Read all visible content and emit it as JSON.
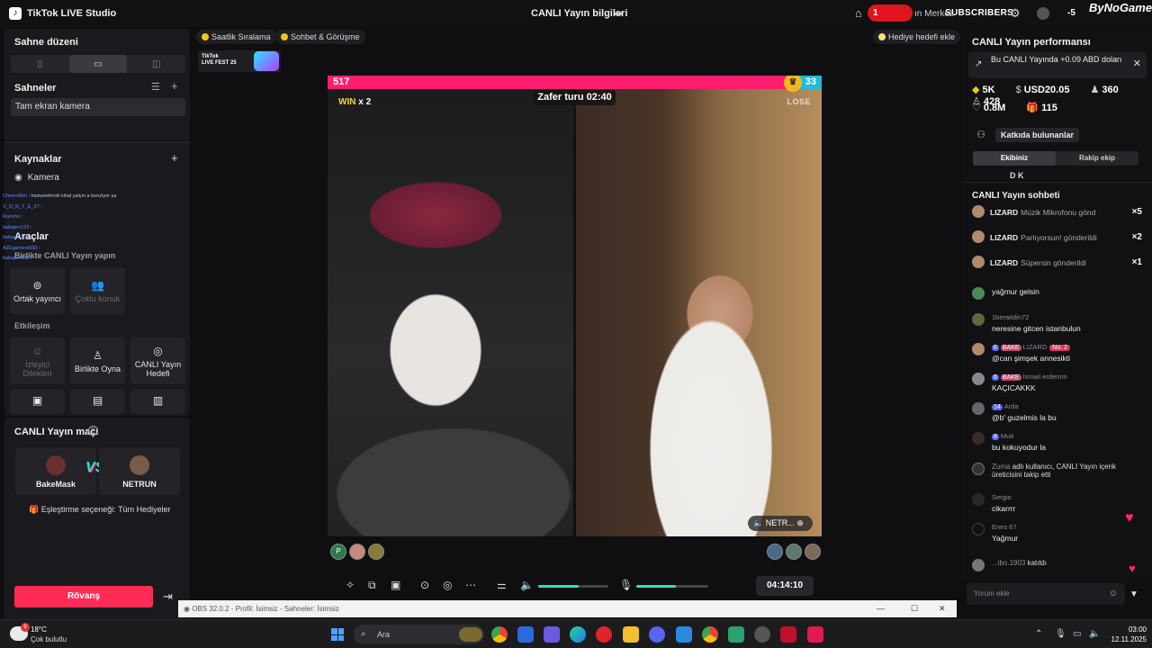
{
  "app": {
    "title": "TikTok LIVE Studio",
    "center_title": "CANLI Yayın bilgileri",
    "brand": "ByNoGame"
  },
  "topright": {
    "pill": "1",
    "yayin_merkezi": "ın Merkez",
    "subscribers": "SUBSCRIBERS",
    "count": "-5"
  },
  "left": {
    "sahne_duzeni": "Sahne düzeni",
    "sahneler": "Sahneler",
    "scene_item": "Tam ekran kamera",
    "kaynaklar": "Kaynaklar",
    "source_camera": "Kamera",
    "araclar": "Araçlar",
    "birlikte_yayin": "Birlikte CANLI Yayın yapın",
    "ortak_yayinci": "Ortak yayıncı",
    "coklu_konuk": "Çoklu konuk",
    "etkilesim": "Etkileşim",
    "izleyici_dilekleri": "İzleyici Dilekleri",
    "birlikte_oyna": "Birlikte Oyna",
    "canli_hedef": "CANLI Yayın Hedefi"
  },
  "overlay_chat": [
    {
      "user": "CheersMet",
      "text": ": hamzeefendi nihal yalçın a benziyor ya"
    },
    {
      "user": "V_O_R_T_E_X7",
      "text": ":"
    },
    {
      "user": "Runnho",
      "text": ":"
    },
    {
      "user": "babapro133",
      "text": ":"
    },
    {
      "user": "babapro133",
      "text": ":"
    },
    {
      "user": "AZEgamers033",
      "text": ":"
    },
    {
      "user": "babapro133",
      "text": ":"
    }
  ],
  "match": {
    "title": "CANLI Yayın maçı",
    "player_left": "BakeMask",
    "player_right": "NETRUN",
    "vs": "VS",
    "eslestirme": "Eşleştirme seçeneği: Tüm Hediyeler",
    "rovans": "Rövanş"
  },
  "chips": {
    "saatlik": "Saatlik Sıralama",
    "sohbet": "Sohbet & Görüşme",
    "hediye": "Hediye hedefi ekle"
  },
  "fest": {
    "line1": "TikTok",
    "line2": "LIVE FEST 25"
  },
  "battle": {
    "score_left": "517",
    "score_right": "33",
    "left_share": 0.94,
    "timer": "Zafer turu 02:40",
    "win": "WIN",
    "win_mult": "x 2",
    "lose": "LOSE",
    "right_name": "NETR..."
  },
  "viewers_left": [
    "P",
    "",
    ""
  ],
  "viewers_right": [
    "",
    "",
    ""
  ],
  "controls": {
    "time": "04:14:10",
    "volume_level": 0.58,
    "mic_level": 0.55
  },
  "obs": {
    "title": "OBS 32.0.2 - Profil: İsimsiz - Sahneler: İsimsiz"
  },
  "right": {
    "perf_title": "CANLI Yayın performansı",
    "earn_text": "Bu CANLI Yayında +0.09 ABD doları",
    "stat_diamonds": "5K",
    "stat_usd": "USD20.05",
    "stat_viewers": "360",
    "stat_users": "428",
    "stat_likes": "0.8M",
    "stat_gifts": "115",
    "katkida": "Katkıda bulunanlar",
    "tab_ekibiniz": "Ekibiniz",
    "tab_rakip": "Rakip ekip",
    "dk": "D K"
  },
  "chat": {
    "title": "CANLI Yayın sohbeti",
    "gifts": [
      {
        "user": "LIZARD",
        "text": "Müzik Mikrofonu gönd",
        "mult": "×5"
      },
      {
        "user": "LIZARD",
        "text": "Parlıyorsun! gönderildi",
        "mult": "×2"
      },
      {
        "user": "LIZARD",
        "text": "Süpersin gönderildi",
        "mult": "×1"
      }
    ],
    "messages": [
      {
        "name": "",
        "text": "yağmur gelsin"
      },
      {
        "name": "1beratidin72",
        "text": "neresine gitcen istanbulun"
      },
      {
        "name": "LIZARD",
        "text": "@can şimşek annesikti",
        "lv": "6",
        "fan": "BAKE",
        "no": "No. 2"
      },
      {
        "name": "İsmail erdemm",
        "text": "KAÇICAKKK",
        "lv": "6",
        "fan": "BAKE"
      },
      {
        "name": "Arda",
        "text": "@b' guzelmis la bu",
        "lv": "14"
      },
      {
        "name": "Muti",
        "text": "bu kokuyodur la",
        "lv": "8"
      },
      {
        "name": "Zuma",
        "text": "adlı kullanıcı, CANLI Yayın içerik üreticisini takip etti"
      },
      {
        "name": "Sergio",
        "text": "cikarrrr"
      },
      {
        "name": "Enes 67",
        "text": "Yağmur"
      },
      {
        "name": "...ibo.1903",
        "text": "katıldı"
      }
    ],
    "input_placeholder": "Yorum ekle"
  },
  "taskbar": {
    "badge": "9",
    "temp": "18°C",
    "weather": "Çok bulutlu",
    "search": "Ara",
    "time": "03:00",
    "date": "12.11.2025"
  }
}
